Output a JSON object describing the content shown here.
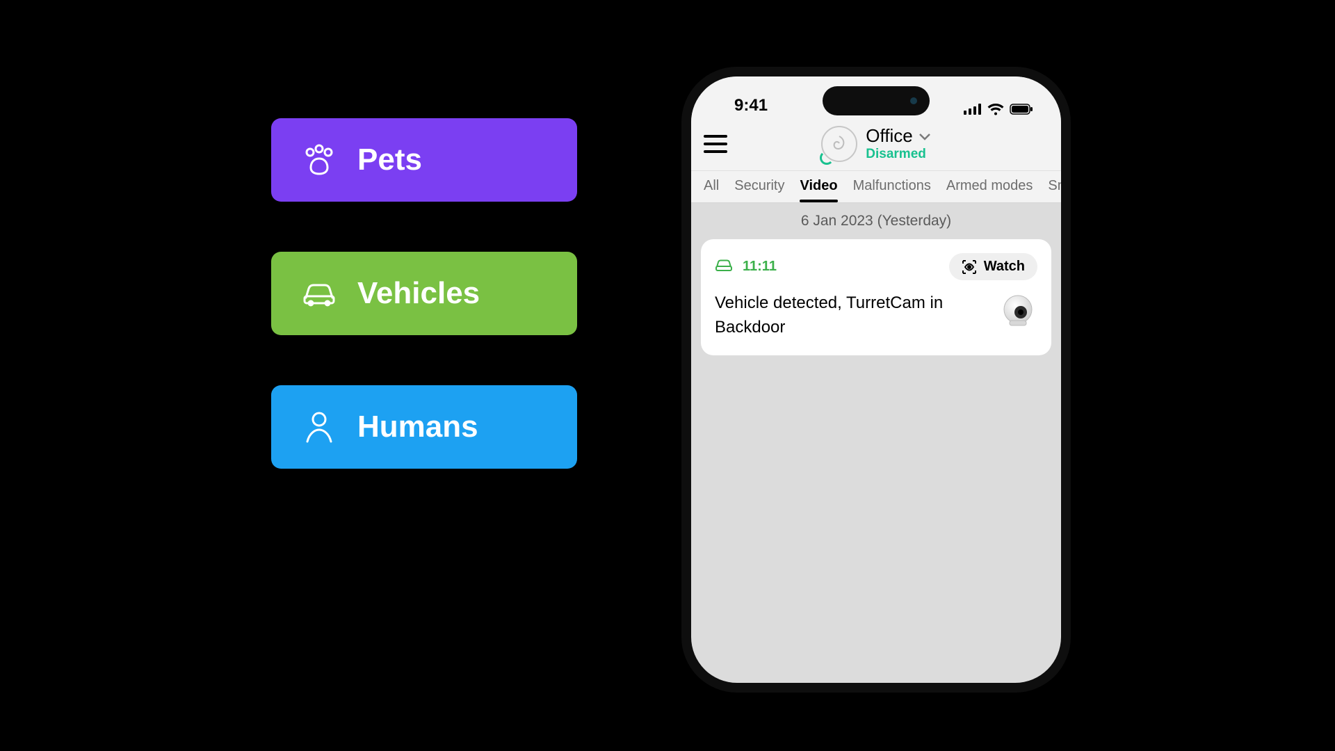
{
  "categories": {
    "pets": {
      "label": "Pets",
      "color": "#7b3ff2"
    },
    "vehicles": {
      "label": "Vehicles",
      "color": "#7ac143"
    },
    "humans": {
      "label": "Humans",
      "color": "#1da1f2"
    }
  },
  "statusbar": {
    "time": "9:41"
  },
  "header": {
    "location": "Office",
    "arm_state": "Disarmed"
  },
  "tabs": {
    "items": [
      "All",
      "Security",
      "Video",
      "Malfunctions",
      "Armed modes",
      "Sma"
    ],
    "active_index": 2
  },
  "feed": {
    "date_label": "6 Jan 2023 (Yesterday)",
    "event": {
      "time": "11:11",
      "watch_label": "Watch",
      "description": "Vehicle detected, TurretCam in Backdoor",
      "type_icon": "car"
    }
  }
}
